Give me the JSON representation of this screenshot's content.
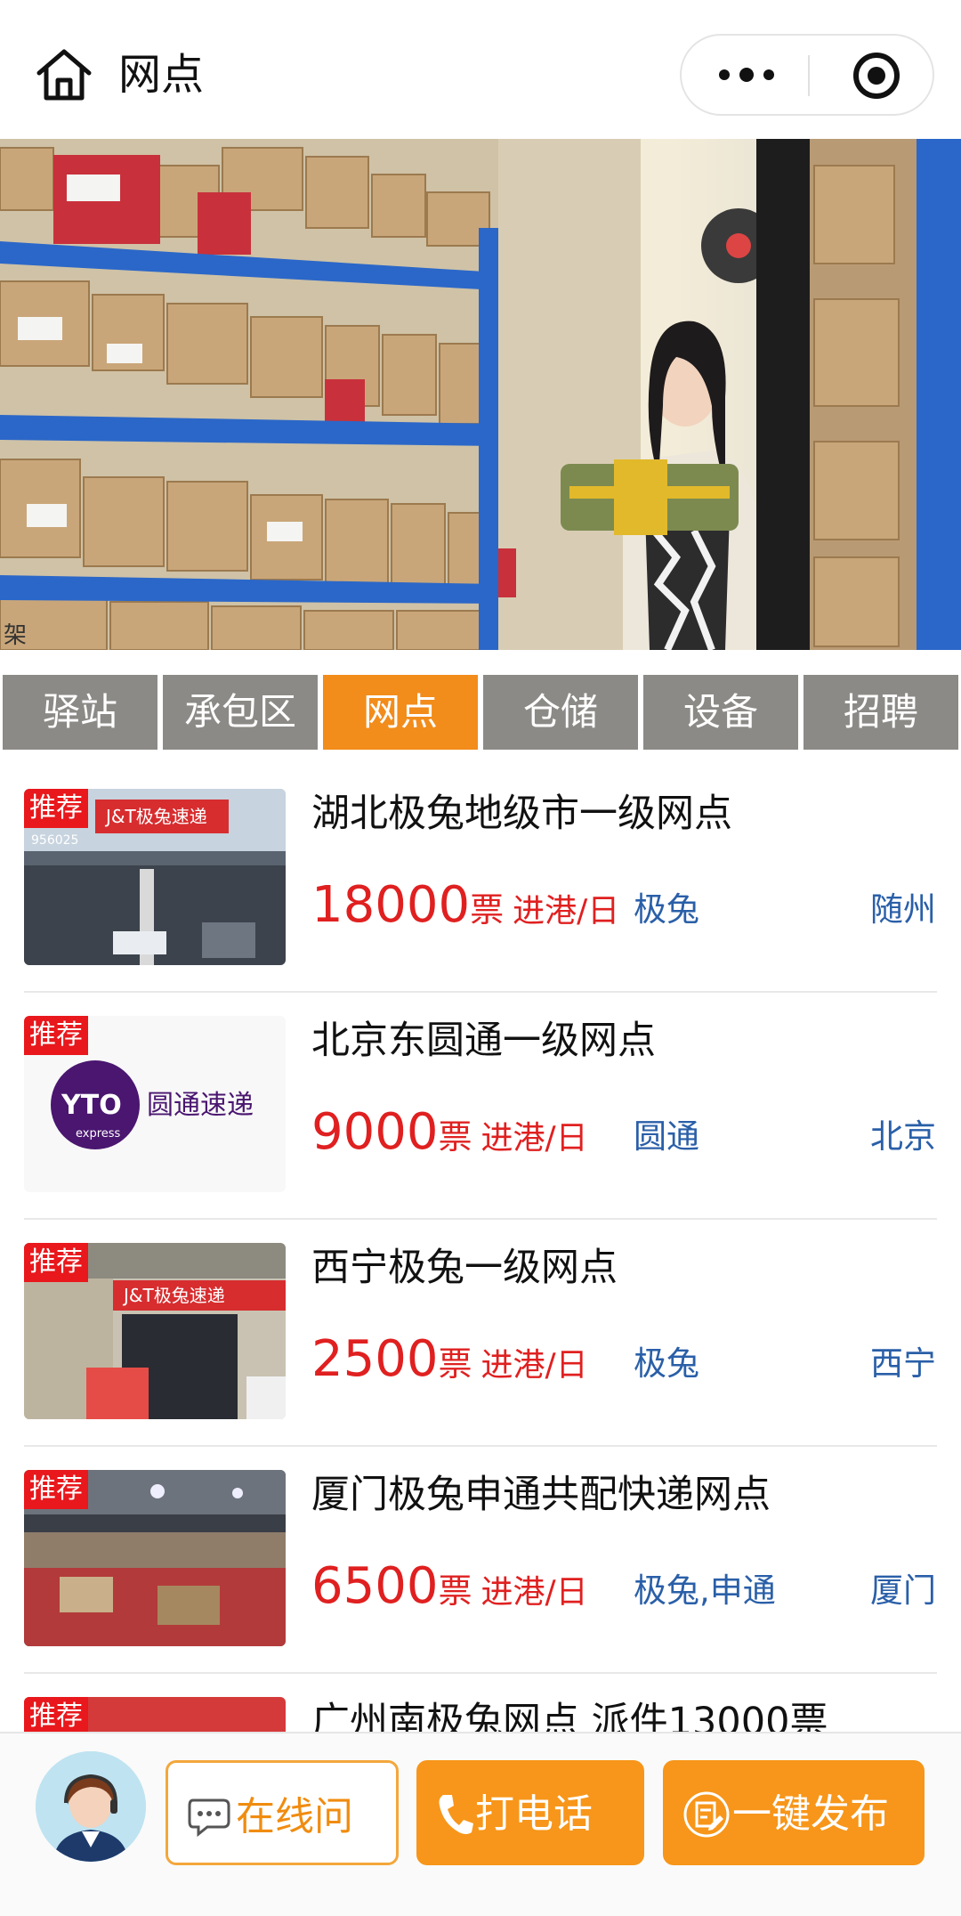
{
  "header": {
    "title": "网点"
  },
  "tabs": [
    {
      "label": "驿站",
      "active": false
    },
    {
      "label": "承包区",
      "active": false
    },
    {
      "label": "网点",
      "active": true
    },
    {
      "label": "仓储",
      "active": false
    },
    {
      "label": "设备",
      "active": false
    },
    {
      "label": "招聘",
      "active": false
    }
  ],
  "listing_common": {
    "badge": "推荐",
    "unit": "票",
    "direction": "进港/日"
  },
  "listings": [
    {
      "title": "湖北极兔地级市一级网点",
      "count": "18000",
      "brand": "极兔",
      "city": "随州"
    },
    {
      "title": "北京东圆通一级网点",
      "count": "9000",
      "brand": "圆通",
      "city": "北京"
    },
    {
      "title": "西宁极兔一级网点",
      "count": "2500",
      "brand": "极兔",
      "city": "西宁"
    },
    {
      "title": "厦门极兔申通共配快递网点",
      "count": "6500",
      "brand": "极兔,申通",
      "city": "厦门"
    },
    {
      "title": "广州南极兔网点 派件13000票"
    }
  ],
  "thumb_text": {
    "jt_sign": "J&T极兔速递",
    "hotline": "956025",
    "yto_logo": "YTO",
    "yto_sub": "express",
    "yto_name": "圆通速递"
  },
  "banner_text": {
    "shelf_label": "架"
  },
  "bottom": {
    "chat_label": "在线问",
    "call_label": "打电话",
    "publish_label": "一键发布"
  },
  "colors": {
    "accent": "#f28c1b",
    "tab_inactive": "#8c8a86",
    "price_red": "#e02020",
    "link_blue": "#2a5fa8",
    "badge_red": "#e8181c"
  }
}
